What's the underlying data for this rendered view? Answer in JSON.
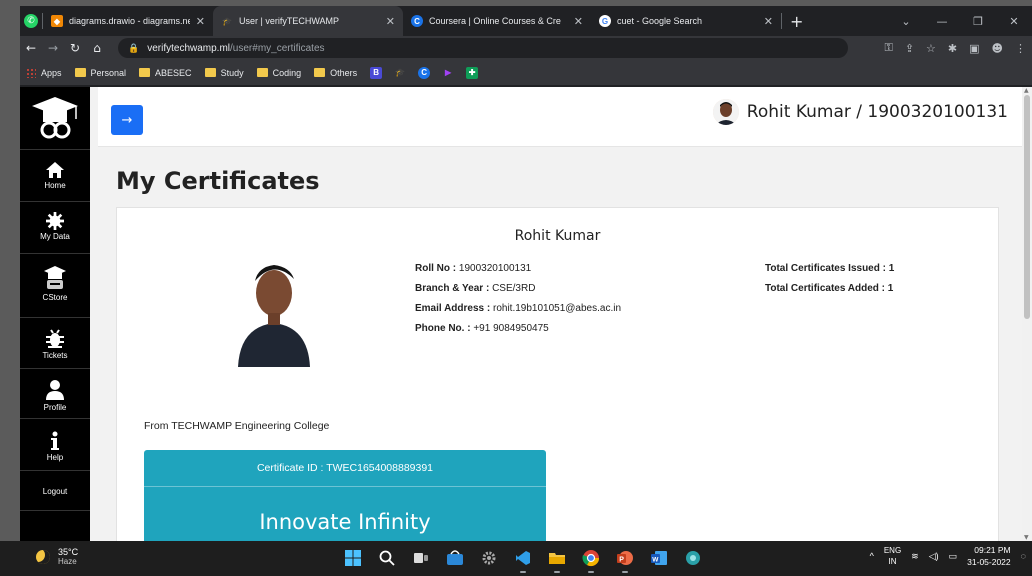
{
  "browser": {
    "tabs": [
      {
        "title": "diagrams.drawio - diagrams.net",
        "favicon": "drawio-icon",
        "color": "#f08705",
        "active": false
      },
      {
        "title": "User | verifyTECHWAMP",
        "favicon": "graduation-cap-icon",
        "color": "#ffffff",
        "active": true
      },
      {
        "title": "Coursera | Online Courses & Cre",
        "favicon": "coursera-icon",
        "color": "#1a73e8",
        "active": false
      },
      {
        "title": "cuet - Google Search",
        "favicon": "google-icon",
        "color": "#ffffff",
        "active": false
      }
    ],
    "url_host": "verifytechwamp.ml",
    "url_path": "/user#my_certificates",
    "bookmarks": [
      {
        "label": "Apps",
        "type": "apps"
      },
      {
        "label": "Personal",
        "type": "folder"
      },
      {
        "label": "ABESEC",
        "type": "folder"
      },
      {
        "label": "Study",
        "type": "folder"
      },
      {
        "label": "Coding",
        "type": "folder"
      },
      {
        "label": "Others",
        "type": "folder"
      }
    ]
  },
  "sidebar": {
    "items": [
      {
        "label": "Home",
        "icon": "home-icon"
      },
      {
        "label": "My Data",
        "icon": "gear-icon"
      },
      {
        "label": "CStore",
        "icon": "store-icon"
      },
      {
        "label": "Tickets",
        "icon": "bug-icon"
      },
      {
        "label": "Profile",
        "icon": "user-icon"
      },
      {
        "label": "Help",
        "icon": "info-icon"
      },
      {
        "label": "Logout",
        "icon": ""
      }
    ]
  },
  "header": {
    "toggle_symbol": "→",
    "user_label": "Rohit Kumar / 1900320100131"
  },
  "main": {
    "title": "My Certificates",
    "student": {
      "name": "Rohit Kumar",
      "roll_label": "Roll No :",
      "roll": "1900320100131",
      "branch_label": "Branch & Year :",
      "branch": "CSE/3RD",
      "email_label": "Email Address :",
      "email": "rohit.19b101051@abes.ac.in",
      "phone_label": "Phone No. :",
      "phone": "+91 9084950475",
      "issued_label": "Total Certificates Issued :",
      "issued": "1",
      "added_label": "Total Certificates Added :",
      "added": "1",
      "college": "From TECHWAMP Engineering College"
    },
    "certificate": {
      "id_label": "Certificate ID : TWEC1654008889391",
      "title": "Innovate Infinity"
    }
  },
  "taskbar": {
    "temperature": "35°C",
    "weather": "Haze",
    "lang_top": "ENG",
    "lang_bottom": "IN",
    "time": "09:21 PM",
    "date": "31-05-2022"
  },
  "colors": {
    "accent_button": "#1a6ef5",
    "certificate_bg": "#1fa4bd",
    "sidebar_bg": "#000000"
  }
}
